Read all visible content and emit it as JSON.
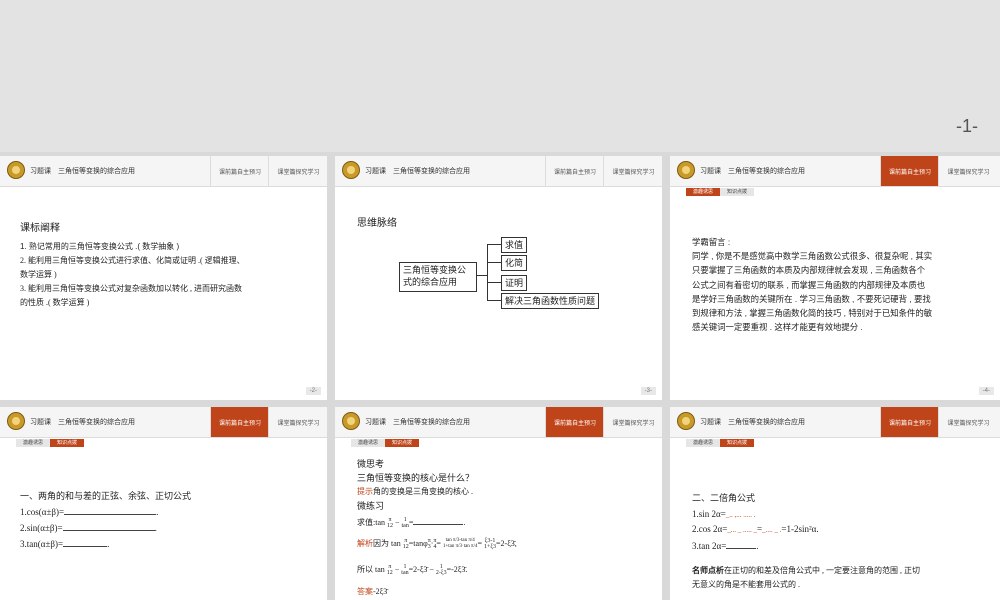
{
  "top": {
    "page_num": "-1-"
  },
  "header": {
    "title": "习题课　三角恒等变换的综合应用",
    "tab_preview": "课前篇自主预习",
    "tab_explore": "课堂篇探究学习"
  },
  "subtabs": {
    "a": "激趣诱思",
    "b": "知识点拨"
  },
  "slide2": {
    "heading": "课标阐释",
    "items": [
      "1. 熟记常用的三角恒等变换公式 .( 数学抽象 )",
      "2. 能利用三角恒等变换公式进行求值、化简或证明 .( 逻辑推理、",
      "数学运算 )",
      "3. 能利用三角恒等变换公式对复杂函数加以转化 , 进而研究函数",
      "的性质 .( 数学运算 )"
    ],
    "page": "-2-"
  },
  "slide3": {
    "heading": "思维脉络",
    "center_line1": "三角恒等变换公",
    "center_line2": "式的综合应用",
    "branches": [
      "求值",
      "化简",
      "证明",
      "解决三角函数性质问题"
    ],
    "page": "-3-"
  },
  "slide4": {
    "lines": [
      "学霸留言 :",
      "同学 , 你是不是感觉高中数学三角函数公式很多、很复杂呢 , 其实",
      "只要掌握了三角函数的本质及内部规律就会发现 , 三角函数各个",
      "公式之间有着密切的联系 , 而掌握三角函数的内部规律及本质也",
      "是学好三角函数的关键所在 . 学习三角函数 , 不要死记硬背 , 要找",
      "到规律和方法 , 掌握三角函数化简的技巧 , 特别对于已知条件的敏",
      "感关键词一定要重视 . 这样才能更有效地提分 ."
    ],
    "page": "-4-"
  },
  "slide5": {
    "heading": "一、两角的和与差的正弦、余弦、正切公式",
    "f1": "1.cos(α±β)=",
    "f2": "2.sin(α±β)=",
    "f3": "3.tan(α±β)="
  },
  "slide6": {
    "l1": "微思考",
    "l2": "三角恒等变换的核心是什么？",
    "l3a": "提示",
    "l3b": "角的变换是三角变换的核心 .",
    "l4": "微练习",
    "l5": "求值:tan",
    "l6a": "解析",
    "l6b": "因为 tan",
    "l6c": "=tanφ",
    "l6d": "=",
    "l6e": "=",
    "l6f": "=2-ξ3̄,",
    "l7a": "所以 tan",
    "l7b": "=2-ξ3̄ −",
    "l7c": "=-2ξ3̄.",
    "l8a": "答案",
    "l8b": "-2ξ3̄",
    "frac": {
      "pi": "π",
      "n12": "12",
      "one": "1",
      "tan": "tan",
      "pi3": "π",
      "d3": "3",
      "pi4": "π",
      "d4": "4",
      "dot": "·",
      "top1": "tan π/3-tan π/4",
      "bot1": "1+tan π/3·tan π/4",
      "top2": "ξ3-1",
      "bot2": "1+ξ3",
      "bot3": "2-ξ3"
    }
  },
  "slide7": {
    "heading": "二、二倍角公式",
    "f1": "1.sin 2α=",
    "f1_fill": "_.. ,... ..... .",
    "f2a": "2.cos 2α=",
    "f2b": "_... _ ..... _",
    "f2c": "=",
    "f2d": "_.... _ .",
    "f2e": "=1-2sin²α.",
    "f3": "3.tan 2α=",
    "tip_a": "名师点析",
    "tip_b": "在正切的和差及倍角公式中 , 一定要注意角的范围 , 正切",
    "tip_c": "无意义的角是不能套用公式的 ."
  }
}
